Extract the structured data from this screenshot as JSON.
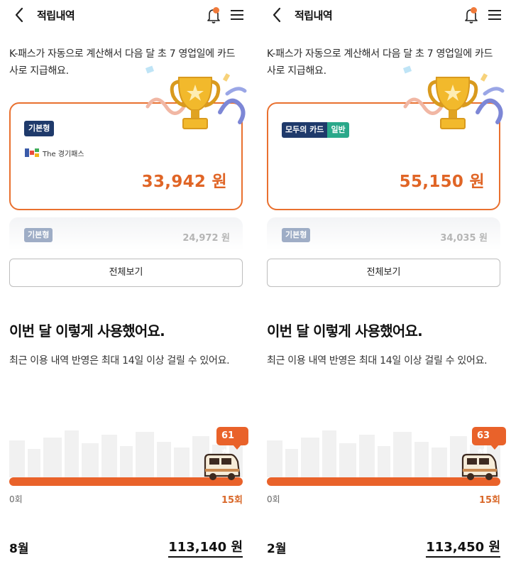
{
  "screens": [
    {
      "header": {
        "title": "적립내역"
      },
      "description": "K-패스가 자동으로 계산해서 다음 달 초 7 영업일에 카드사로 지급해요.",
      "main_card": {
        "badge": "기본형",
        "issuer_logo_text": "The 경기패스",
        "amount": "33,942 원"
      },
      "next_card": {
        "badge": "기본형",
        "amount": "24,972 원"
      },
      "view_all_label": "전체보기",
      "usage": {
        "heading": "이번 달 이렇게 사용했어요.",
        "note": "최근 이용 내역 반영은 최대 14일 이상 걸릴 수 있어요.",
        "count_badge": "61 회",
        "progress": 1.0,
        "min_label": "0회",
        "goal_label": "15회"
      },
      "summary": {
        "month": "8월",
        "total": "113,140 원"
      }
    },
    {
      "header": {
        "title": "적립내역"
      },
      "description": "K-패스가 자동으로 계산해서 다음 달 초 7 영업일에 카드사로 지급해요.",
      "main_card": {
        "badge_left": "모두의 카드",
        "badge_right": "일반",
        "amount": "55,150 원"
      },
      "next_card": {
        "badge": "기본형",
        "amount": "34,035 원"
      },
      "view_all_label": "전체보기",
      "usage": {
        "heading": "이번 달 이렇게 사용했어요.",
        "note": "최근 이용 내역 반영은 최대 14일 이상 걸릴 수 있어요.",
        "count_badge": "63 회",
        "progress": 1.0,
        "min_label": "0회",
        "goal_label": "15회"
      },
      "summary": {
        "month": "2월",
        "total": "113,450 원"
      }
    }
  ],
  "colors": {
    "accent": "#e9622a",
    "badge_navy": "#1f3a6b",
    "badge_green": "#2aa88a"
  },
  "icons": [
    "back-arrow-icon",
    "bell-icon",
    "menu-icon",
    "trophy-icon",
    "van-icon",
    "city-skyline"
  ]
}
